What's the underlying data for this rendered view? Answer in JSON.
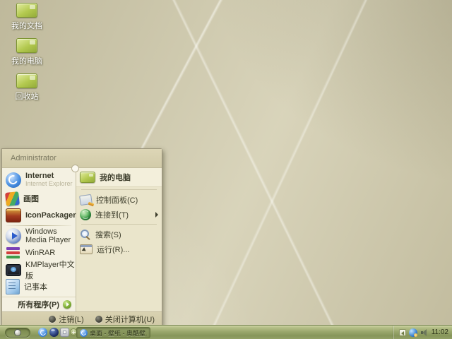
{
  "desktop": {
    "icons": [
      {
        "label": "我的文档",
        "icon": "my-documents-icon"
      },
      {
        "label": "我的电脑",
        "icon": "my-computer-icon"
      },
      {
        "label": "回收站",
        "icon": "recycle-bin-icon"
      }
    ]
  },
  "start_menu": {
    "user_name": "Administrator",
    "pinned": [
      {
        "label": "Internet",
        "sublabel": "Internet Explorer",
        "icon": "internet-explorer-icon"
      },
      {
        "label": "画图",
        "icon": "paint-icon"
      },
      {
        "label": "IconPackager",
        "icon": "iconpackager-icon"
      }
    ],
    "recent": [
      {
        "label": "Windows Media Player",
        "icon": "media-player-icon"
      },
      {
        "label": "WinRAR",
        "icon": "winrar-icon"
      },
      {
        "label": "KMPlayer中文版",
        "icon": "kmplayer-icon"
      },
      {
        "label": "记事本",
        "icon": "notepad-icon"
      }
    ],
    "all_programs_label": "所有程序(P)",
    "places": [
      {
        "label": "我的电脑",
        "icon": "my-computer-icon",
        "highlighted": true
      },
      {
        "label": "控制面板(C)",
        "icon": "control-panel-icon"
      },
      {
        "label": "连接到(T)",
        "icon": "connect-to-icon",
        "has_submenu": true
      },
      {
        "label": "搜索(S)",
        "icon": "search-icon"
      },
      {
        "label": "运行(R)...",
        "icon": "run-icon"
      }
    ],
    "footer": {
      "log_off_label": "注销(L)",
      "shut_down_label": "关闭计算机(U)"
    }
  },
  "taskbar": {
    "window_button_label": "桌面 - 壁纸 - 奥酷壁...",
    "clock": "11:02"
  },
  "icons_legend": {
    "start-orb-icon": "grey sphere in pill",
    "quicklaunch-ie-icon": "blue e circle",
    "quicklaunch-ball-icon": "dark navy sphere",
    "quicklaunch-window-icon": "grey window square",
    "quicklaunch-expand-icon": "small plus badge",
    "tray-hidden-icons-icon": "left chevron badge",
    "tray-network-icon": "blue globe with gold dot",
    "tray-volume-icon": "speaker"
  },
  "colors": {
    "wallpaper_base": "#cec8aa",
    "taskbar_olive": "#94a264",
    "menu_chrome": "#d7d0af",
    "menu_left_bg": "#f4f1e2",
    "menu_right_bg": "#eae5cb",
    "highlight_row": "#f3efdb",
    "folder_green": "#a8bf44",
    "desktop_label_text": "#ffffff"
  }
}
